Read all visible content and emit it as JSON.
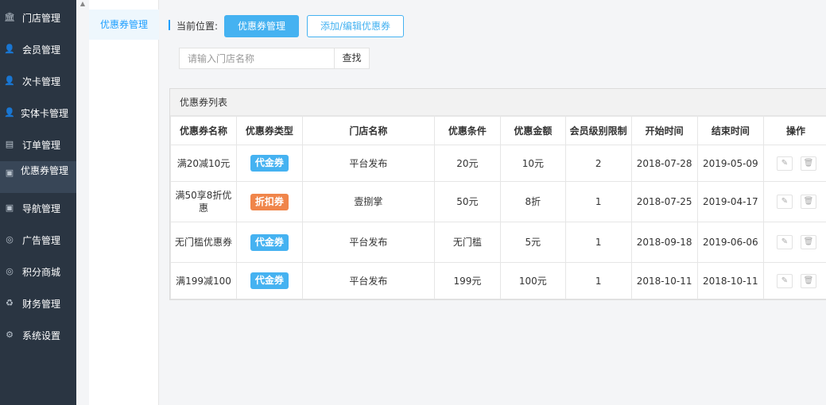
{
  "colors": {
    "accent": "#45b2f1",
    "nav_bg": "#2a3542",
    "badge_cash": "#45b2f1",
    "badge_discount": "#f0854a"
  },
  "nav": {
    "items": [
      {
        "label": "门店管理",
        "icon": "bank-icon",
        "glyph": "🏛"
      },
      {
        "label": "会员管理",
        "icon": "user-icon",
        "glyph": "👤"
      },
      {
        "label": "次卡管理",
        "icon": "user-icon",
        "glyph": "👤"
      },
      {
        "label": "实体卡管理",
        "icon": "user-icon",
        "glyph": "👤"
      },
      {
        "label": "订单管理",
        "icon": "file-icon",
        "glyph": "▤"
      },
      {
        "label": "优惠券管理",
        "icon": "money-icon",
        "glyph": "▣"
      },
      {
        "label": "导航管理",
        "icon": "money-icon",
        "glyph": "▣"
      },
      {
        "label": "广告管理",
        "icon": "life-ring-icon",
        "glyph": "◎"
      },
      {
        "label": "积分商城",
        "icon": "life-ring-icon",
        "glyph": "◎"
      },
      {
        "label": "财务管理",
        "icon": "recycle-icon",
        "glyph": "♻"
      },
      {
        "label": "系统设置",
        "icon": "gear-icon",
        "glyph": "⚙"
      }
    ]
  },
  "subnav": {
    "item": "优惠券管理"
  },
  "breadcrumb": {
    "label": "当前位置:",
    "current": "优惠券管理",
    "secondary": "添加/编辑优惠券"
  },
  "search": {
    "placeholder": "请输入门店名称",
    "button": "查找"
  },
  "panel": {
    "title": "优惠券列表"
  },
  "table": {
    "columns": [
      "优惠券名称",
      "优惠券类型",
      "门店名称",
      "优惠条件",
      "优惠金额",
      "会员级别限制",
      "开始时间",
      "结束时间",
      "操作"
    ],
    "rows": [
      {
        "name": "满20减10元",
        "type": "代金券",
        "type_kind": "cash",
        "store": "平台发布",
        "condition": "20元",
        "amount": "10元",
        "level": "2",
        "start": "2018-07-28",
        "end": "2019-05-09"
      },
      {
        "name": "满50享8折优惠",
        "type": "折扣券",
        "type_kind": "discount",
        "store": "壹捌掌",
        "condition": "50元",
        "amount": "8折",
        "level": "1",
        "start": "2018-07-25",
        "end": "2019-04-17"
      },
      {
        "name": "无门槛优惠券",
        "type": "代金券",
        "type_kind": "cash",
        "store": "平台发布",
        "condition": "无门槛",
        "amount": "5元",
        "level": "1",
        "start": "2018-09-18",
        "end": "2019-06-06"
      },
      {
        "name": "满199减100",
        "type": "代金券",
        "type_kind": "cash",
        "store": "平台发布",
        "condition": "199元",
        "amount": "100元",
        "level": "1",
        "start": "2018-10-11",
        "end": "2018-10-11"
      }
    ]
  },
  "row_actions": {
    "edit_icon": "pencil-icon",
    "delete_icon": "trash-icon",
    "edit_glyph": "✎",
    "delete_glyph": "🗑"
  }
}
